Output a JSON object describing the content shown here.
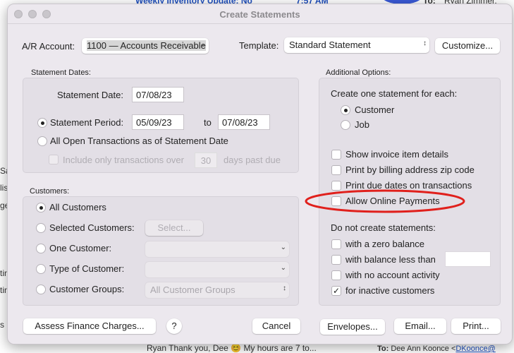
{
  "background": {
    "email_subject": "Weekly Inventory Update: No",
    "email_time": "7:57 AM",
    "to_label": "To:",
    "to_name": "Ryan Zimmer,",
    "preview": "Ryan Thank you, Dee 😊 My hours are 7 to...",
    "to_line_label": "To:",
    "to_line_name": "Dee Ann Koonce <",
    "to_line_email": "DKoonce@",
    "left_fragments": [
      "Sa",
      "lis",
      "ge",
      "tin",
      "tin",
      "s"
    ]
  },
  "window": {
    "title": "Create Statements"
  },
  "top": {
    "ar_label": "A/R Account:",
    "ar_value": "1100 — Accounts Receivable",
    "template_label": "Template:",
    "template_value": "Standard Statement",
    "customize": "Customize..."
  },
  "dates": {
    "heading": "Statement Dates:",
    "statement_date_label": "Statement Date:",
    "statement_date": "07/08/23",
    "period_label": "Statement Period:",
    "period_from": "05/09/23",
    "to_label": "to",
    "period_to": "07/08/23",
    "period_selected": true,
    "all_open_label": "All Open Transactions as of Statement Date",
    "include_label": "Include only transactions over",
    "days_value": "30",
    "days_label": "days past due"
  },
  "customers": {
    "heading": "Customers:",
    "all": "All Customers",
    "selected": "Selected Customers:",
    "select_btn": "Select...",
    "one": "One Customer:",
    "type": "Type of Customer:",
    "groups": "Customer Groups:",
    "groups_value": "All Customer Groups",
    "selected_option": "All Customers"
  },
  "options": {
    "heading": "Additional Options:",
    "create_each": "Create one statement for each:",
    "customer": "Customer",
    "job": "Job",
    "selected": "Customer",
    "show_details": "Show invoice item details",
    "print_zip": "Print by billing address zip code",
    "print_due": "Print due dates on transactions",
    "allow_online": "Allow Online Payments",
    "do_not": "Do not create statements:",
    "zero": "with a zero balance",
    "less_than": "with balance less than",
    "no_activity": "with no account activity",
    "inactive": "for inactive customers",
    "inactive_checked": true,
    "highlight_color": "#e0201c"
  },
  "buttons": {
    "assess": "Assess Finance Charges...",
    "help": "?",
    "cancel": "Cancel",
    "envelopes": "Envelopes...",
    "email": "Email...",
    "print": "Print..."
  }
}
